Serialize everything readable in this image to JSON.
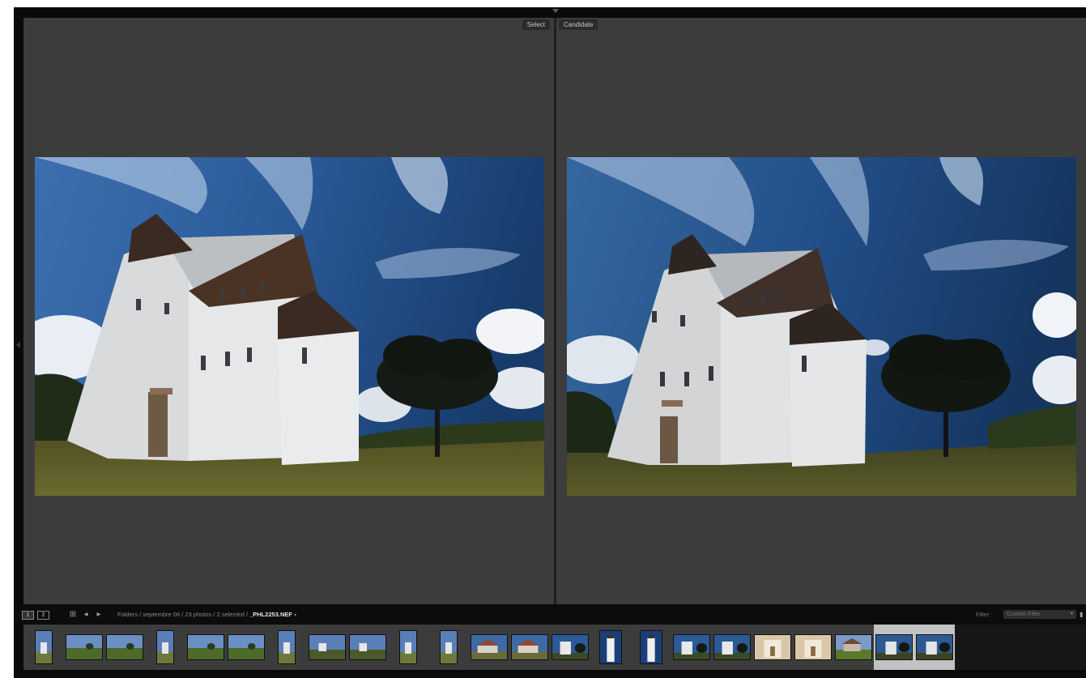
{
  "compare": {
    "select_label": "Select",
    "candidate_label": "Candidate"
  },
  "toolbar": {
    "view_1": "1",
    "view_2": "2",
    "icons": [
      "grid-icon",
      "back-arrow-icon",
      "forward-arrow-icon"
    ],
    "breadcrumb_path": "Folders / septembre 06 / 23 photos / 2 selected / ",
    "current_file": "_PHL2253.NEF",
    "file_menu_caret": "▾",
    "filter_label": "Filter :",
    "filter_value": "Custom Filter",
    "filter_caret": "▾",
    "lock_icon": "lock-icon"
  },
  "filmstrip": {
    "total": 23,
    "selected_count": 2,
    "thumb_kinds": [
      "church-vertical",
      "landscape-green",
      "landscape-green",
      "church-vertical",
      "landscape-green",
      "landscape-green",
      "church-vertical",
      "landscape-church",
      "landscape-church",
      "church-vertical",
      "church-vertical",
      "house-blue",
      "house-blue",
      "church-blue",
      "church-tower",
      "church-tower",
      "church-blue",
      "church-blue",
      "church-warm",
      "church-warm",
      "house-green",
      "church-blue-sel",
      "church-blue-sel"
    ]
  },
  "colors": {
    "panel_bg": "#3c3c3c",
    "app_bg": "#0a0a0a",
    "selected_cell": "#c2c2c2"
  }
}
